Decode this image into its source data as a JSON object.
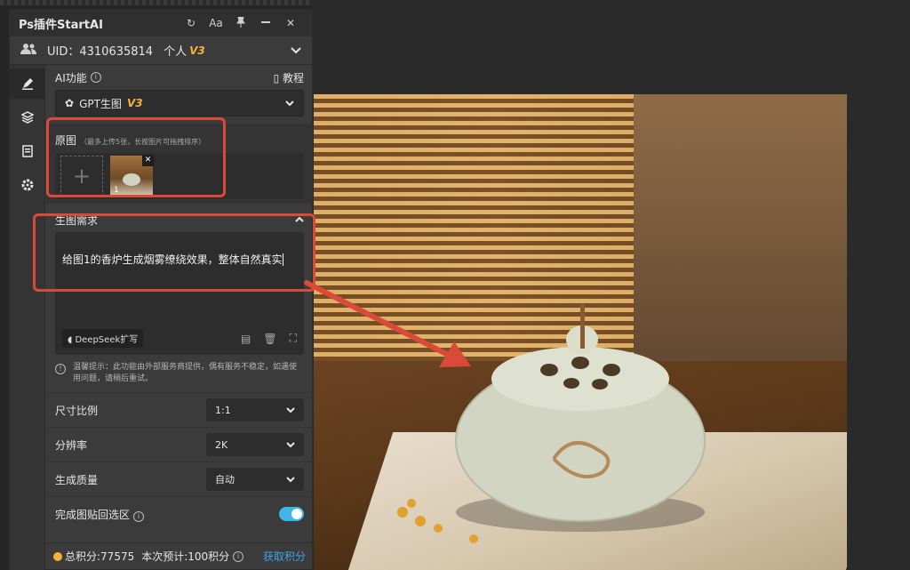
{
  "panel": {
    "title": "Ps插件StartAI",
    "titlebar_buttons": [
      "↻",
      "Aa",
      "✕"
    ],
    "uid_label": "UID：4310635814",
    "tier": "个人",
    "tier_version": "V3"
  },
  "ai_feature": {
    "label": "AI功能",
    "tutorial": "教程",
    "selected": "GPT生图",
    "selected_version": "V3"
  },
  "original": {
    "label": "原图",
    "hint": "（最多上传5张，长按图片可拖拽排序）",
    "add_symbol": "+",
    "thumb_index": "1",
    "remove_symbol": "✕"
  },
  "requirement": {
    "label": "生图需求",
    "prompt": "给图1的香炉生成烟雾缭绕效果，整体自然真实",
    "deepseek_label": "DeepSeek扩写"
  },
  "tip": {
    "text": "温馨提示：此功能由外部服务商提供，偶有服务不稳定，如遇使用问题，请稍后重试。"
  },
  "options": {
    "ratio_label": "尺寸比例",
    "ratio_value": "1:1",
    "resolution_label": "分辨率",
    "resolution_value": "2K",
    "quality_label": "生成质量",
    "quality_value": "自动",
    "paste_label": "完成图贴回选区",
    "paste_enabled": true
  },
  "footer": {
    "total_points": "总积分:77575",
    "estimate": "本次预计:100积分",
    "get_points": "获取积分"
  },
  "colors": {
    "accent_orange": "#f3b33d",
    "toggle_blue": "#3fb5e8",
    "link_blue": "#3fa5e8",
    "annotation_red": "#d94a38"
  }
}
